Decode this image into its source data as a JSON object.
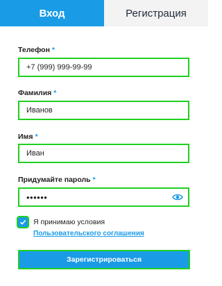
{
  "tabs": {
    "login": "Вход",
    "register": "Регистрация"
  },
  "form": {
    "phone": {
      "label": "Телефон",
      "required_mark": "*",
      "value": "+7 (999) 999-99-99"
    },
    "surname": {
      "label": "Фамилия",
      "required_mark": "*",
      "value": "Иванов"
    },
    "name": {
      "label": "Имя",
      "required_mark": "*",
      "value": "Иван"
    },
    "password": {
      "label": "Придумайте пароль",
      "required_mark": "*",
      "value": "••••••",
      "toggle_icon": "eye-icon"
    }
  },
  "agreement": {
    "checked": true,
    "text": "Я принимаю условия",
    "link": "Пользовательского соглашения"
  },
  "submit_label": "Зарегистрироваться",
  "colors": {
    "accent": "#1a9be6",
    "highlight": "#1fd01f",
    "tab_inactive_bg": "#f3f3f3"
  }
}
